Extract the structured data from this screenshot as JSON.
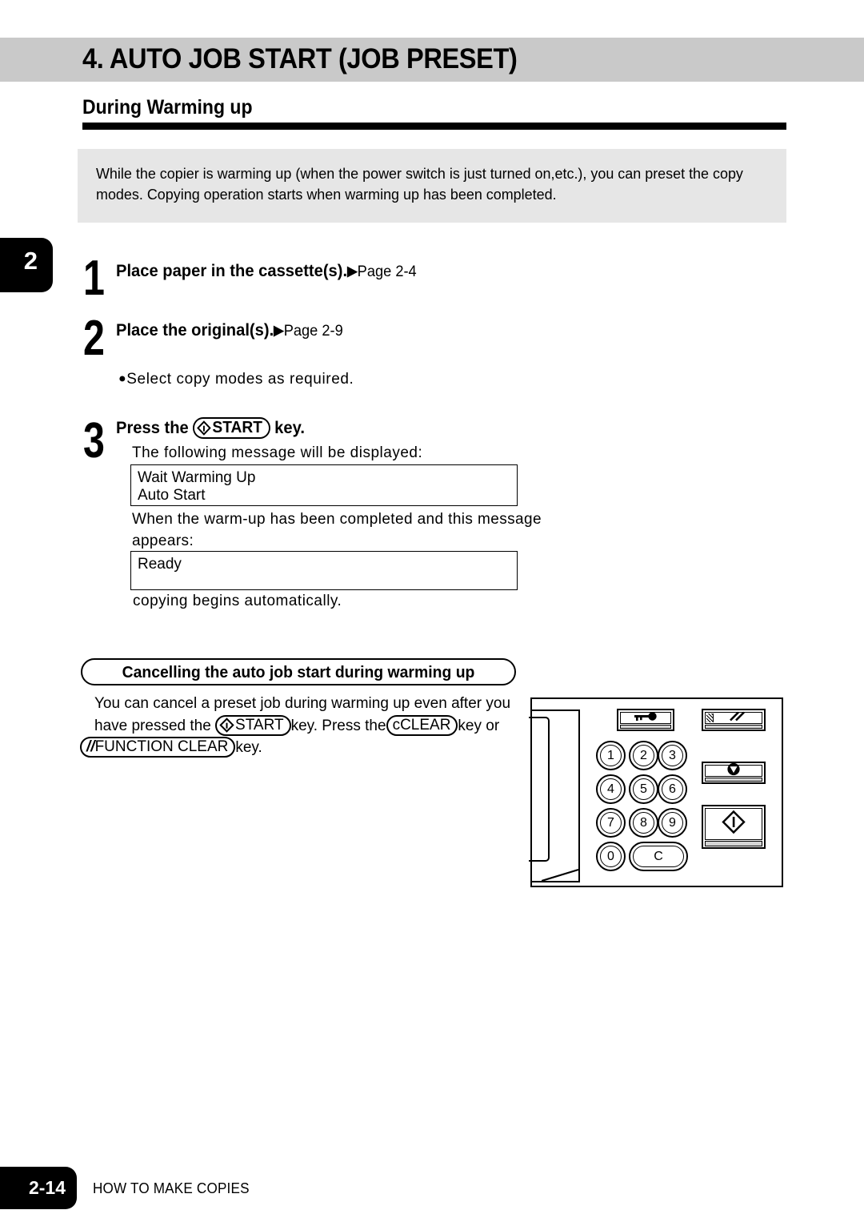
{
  "chapter": {
    "title": "4. AUTO JOB START (JOB PRESET)",
    "tab_number": "2"
  },
  "section": {
    "heading": "During Warming up",
    "intro": "While the copier is warming up (when the power switch is just turned on,etc.), you can preset the copy modes. Copying operation starts when warming up has been completed."
  },
  "steps": [
    {
      "number": "1",
      "text": "Place paper in the cassette(s).",
      "arrow": "▶",
      "page_ref": "Page 2-4"
    },
    {
      "number": "2",
      "text": "Place the original(s).",
      "arrow": "▶",
      "page_ref": "Page 2-9",
      "bullet": "Select copy modes as required.",
      "bullet_marker": "●"
    },
    {
      "number": "3",
      "text_before_key": "Press the",
      "key_label": "START",
      "text_after_key": "key.",
      "line1": "The following message will be displayed:",
      "display1": [
        "Wait Warming Up",
        "Auto Start"
      ],
      "line2": "When the warm-up has been completed and this message appears:",
      "display2": [
        "Ready"
      ],
      "line3": "copying begins automatically."
    }
  ],
  "cancel_section": {
    "pill_title": "Cancelling the auto job start during warming up",
    "line1": "You can cancel a preset job during warming up even after you",
    "line2_a": "have pressed the",
    "line2_key_start": "START",
    "line2_b": "key.   Press the",
    "line2_key_clear_prefix": "c",
    "line2_key_clear": "CLEAR",
    "line2_c": "key or",
    "line3_key_fc_prefix": "//",
    "line3_key_fc": "FUNCTION CLEAR",
    "line3_a": "key."
  },
  "control_panel": {
    "numeric_keys": [
      "1",
      "2",
      "3",
      "4",
      "5",
      "6",
      "7",
      "8",
      "9",
      "0"
    ],
    "clear_key_label": "C",
    "buttons": [
      {
        "name": "auditor-key-button",
        "icon": "key-icon"
      },
      {
        "name": "function-clear-button",
        "icon": "double-slash-icon"
      },
      {
        "name": "stop-button",
        "icon": "stop-triangle-icon"
      },
      {
        "name": "start-button",
        "icon": "start-diamond-icon"
      }
    ]
  },
  "footer": {
    "page_number": "2-14",
    "running_head": "HOW TO MAKE COPIES"
  }
}
